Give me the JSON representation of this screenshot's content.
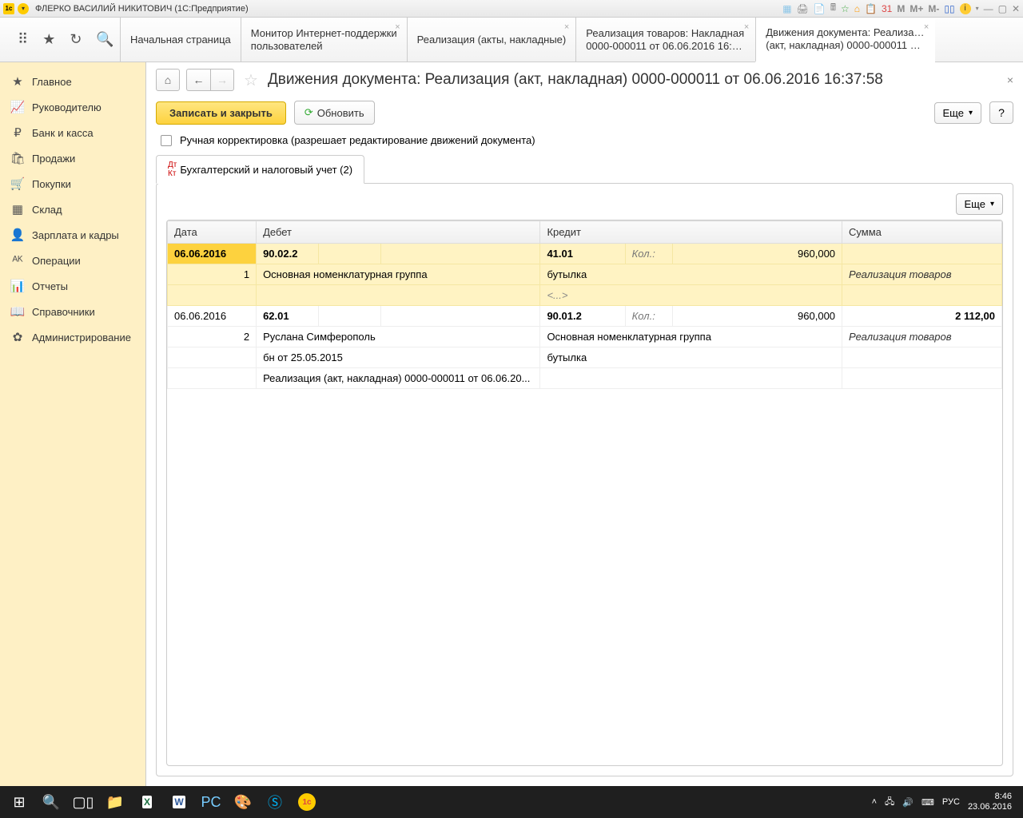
{
  "window_title": "ФЛЕРКО ВАСИЛИЙ НИКИТОВИЧ  (1С:Предприятие)",
  "tabs": [
    {
      "label": "Начальная страница"
    },
    {
      "label": "Монитор Интернет-поддержки",
      "line2": "пользователей"
    },
    {
      "label": "Реализация (акты, накладные)"
    },
    {
      "label": "Реализация товаров: Накладная",
      "line2": "0000-000011 от 06.06.2016 16:37..."
    },
    {
      "label": "Движения документа: Реализация",
      "line2": "(акт, накладная) 0000-000011 от ...",
      "active": true
    }
  ],
  "sidebar": [
    {
      "icon": "★",
      "label": "Главное"
    },
    {
      "icon": "📈",
      "label": "Руководителю"
    },
    {
      "icon": "₽",
      "label": "Банк и касса"
    },
    {
      "icon": "🛍",
      "label": "Продажи"
    },
    {
      "icon": "🛒",
      "label": "Покупки"
    },
    {
      "icon": "▦",
      "label": "Склад"
    },
    {
      "icon": "👤",
      "label": "Зарплата и кадры"
    },
    {
      "icon": "ᴬᴷ",
      "label": "Операции"
    },
    {
      "icon": "📊",
      "label": "Отчеты"
    },
    {
      "icon": "📖",
      "label": "Справочники"
    },
    {
      "icon": "✿",
      "label": "Администрирование"
    }
  ],
  "page_title": "Движения документа: Реализация (акт, накладная) 0000-000011 от 06.06.2016 16:37:58",
  "buttons": {
    "write_close": "Записать и закрыть",
    "refresh": "Обновить",
    "more": "Еще",
    "help": "?"
  },
  "manual_edit_label": "Ручная корректировка (разрешает редактирование движений документа)",
  "doc_tab": "Бухгалтерский и налоговый учет (2)",
  "headers": {
    "date": "Дата",
    "debet": "Дебет",
    "credit": "Кредит",
    "sum": "Сумма"
  },
  "rows": [
    {
      "date": "06.06.2016",
      "n": "1",
      "highlight": true,
      "debet_acc": "90.02.2",
      "debet_sub": [
        "Основная номенклатурная группа"
      ],
      "credit_acc": "41.01",
      "credit_sub": [
        "бутылка",
        "<...>"
      ],
      "qty_label": "Кол.:",
      "qty": "960,000",
      "sum": "",
      "sum_note": "Реализация товаров"
    },
    {
      "date": "06.06.2016",
      "n": "2",
      "debet_acc": "62.01",
      "debet_sub": [
        "Руслана Симферополь",
        "бн от 25.05.2015",
        "Реализация (акт, накладная) 0000-000011 от 06.06.20..."
      ],
      "credit_acc": "90.01.2",
      "credit_sub": [
        "Основная номенклатурная группа",
        "бутылка"
      ],
      "qty_label": "Кол.:",
      "qty": "960,000",
      "sum": "2 112,00",
      "sum_note": "Реализация товаров"
    }
  ],
  "taskbar": {
    "lang": "РУС",
    "time": "8:46",
    "date": "23.06.2016"
  },
  "titlebar_icons": {
    "m": "M",
    "m_plus": "M+",
    "m_minus": "M-"
  }
}
